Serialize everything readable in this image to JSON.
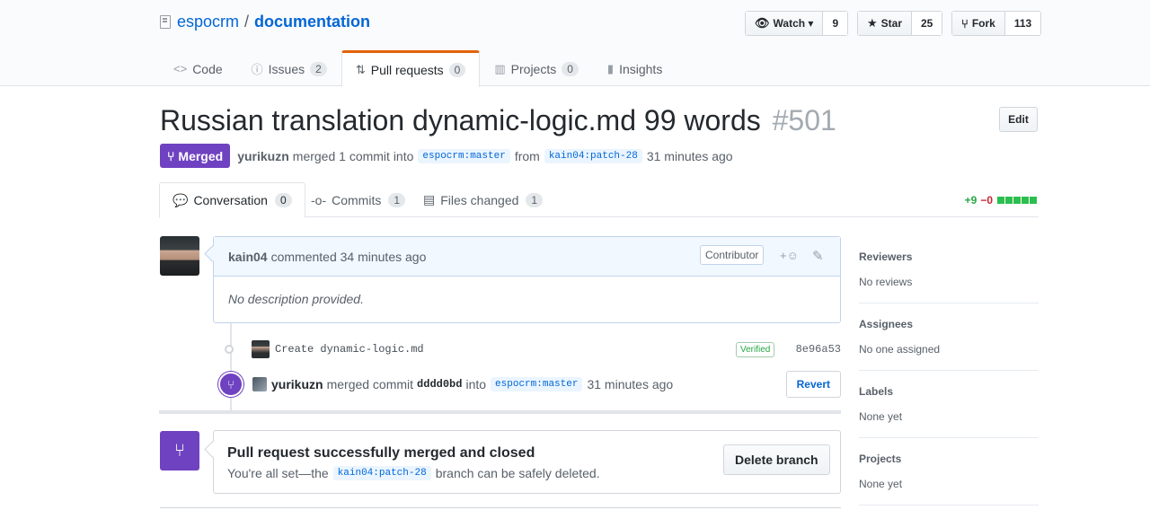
{
  "repo": {
    "owner": "espocrm",
    "separator": "/",
    "name": "documentation"
  },
  "actions": {
    "watch": {
      "label": "Watch ▾",
      "count": "9"
    },
    "star": {
      "label": "Star",
      "count": "25"
    },
    "fork": {
      "label": "Fork",
      "count": "113"
    }
  },
  "nav": {
    "code": "Code",
    "issues": {
      "label": "Issues",
      "count": "2"
    },
    "pulls": {
      "label": "Pull requests",
      "count": "0"
    },
    "projects": {
      "label": "Projects",
      "count": "0"
    },
    "insights": "Insights"
  },
  "pr": {
    "title": "Russian translation dynamic-logic.md 99 words",
    "number": "#501",
    "edit": "Edit",
    "state": "Merged",
    "merger": "yurikuzn",
    "merged_text": "merged 1 commit into",
    "base": "espocrm:master",
    "from_text": "from",
    "head": "kain04:patch-28",
    "time": "31 minutes ago"
  },
  "tabs": {
    "conversation": {
      "label": "Conversation",
      "count": "0"
    },
    "commits": {
      "label": "Commits",
      "count": "1"
    },
    "files": {
      "label": "Files changed",
      "count": "1"
    }
  },
  "diffstat": {
    "additions": "+9",
    "deletions": "−0"
  },
  "comment": {
    "author": "kain04",
    "action": "commented 34 minutes ago",
    "badge": "Contributor",
    "body": "No description provided."
  },
  "commit": {
    "message": "Create dynamic-logic.md",
    "verified": "Verified",
    "sha": "8e96a53"
  },
  "merge_event": {
    "user": "yurikuzn",
    "action": "merged commit",
    "sha": "dddd0bd",
    "into": "into",
    "branch": "espocrm:master",
    "time": "31 minutes ago",
    "revert": "Revert"
  },
  "merged_box": {
    "title": "Pull request successfully merged and closed",
    "desc_pre": "You're all set—the",
    "branch": "kain04:patch-28",
    "desc_post": "branch can be safely deleted.",
    "delete": "Delete branch"
  },
  "sidebar": {
    "reviewers": {
      "label": "Reviewers",
      "value": "No reviews"
    },
    "assignees": {
      "label": "Assignees",
      "value": "No one assigned"
    },
    "labels": {
      "label": "Labels",
      "value": "None yet"
    },
    "projects": {
      "label": "Projects",
      "value": "None yet"
    }
  }
}
